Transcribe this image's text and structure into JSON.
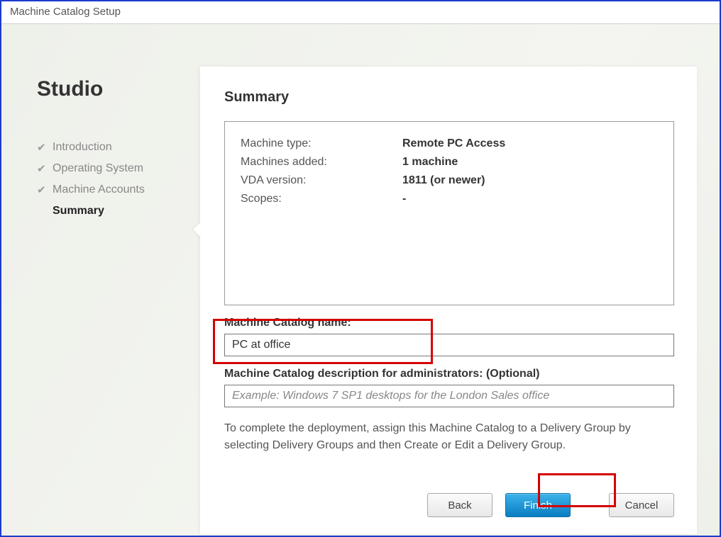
{
  "window": {
    "title": "Machine Catalog Setup"
  },
  "sidebar": {
    "title": "Studio",
    "items": [
      {
        "label": "Introduction",
        "done": true,
        "current": false
      },
      {
        "label": "Operating System",
        "done": true,
        "current": false
      },
      {
        "label": "Machine Accounts",
        "done": true,
        "current": false
      },
      {
        "label": "Summary",
        "done": false,
        "current": true
      }
    ]
  },
  "panel": {
    "title": "Summary",
    "summary": [
      {
        "key": "Machine type:",
        "value": "Remote PC Access"
      },
      {
        "key": "Machines added:",
        "value": "1 machine"
      },
      {
        "key": "VDA version:",
        "value": "1811 (or newer)"
      },
      {
        "key": "Scopes:",
        "value": "-"
      }
    ],
    "name_label": "Machine Catalog name:",
    "name_value": "PC at office",
    "desc_label": "Machine Catalog description for administrators: (Optional)",
    "desc_placeholder": "Example: Windows 7 SP1 desktops for the London Sales office",
    "desc_value": "",
    "hint": "To complete the deployment, assign this Machine Catalog to a Delivery Group by selecting Delivery Groups and then Create or Edit a Delivery Group."
  },
  "buttons": {
    "back": "Back",
    "finish": "Finish",
    "cancel": "Cancel"
  },
  "highlights": {
    "name_field": true,
    "finish_button": true
  },
  "colors": {
    "accent": "#1a3ccc",
    "primary_button": "#1b8acb",
    "highlight": "#d40000"
  }
}
